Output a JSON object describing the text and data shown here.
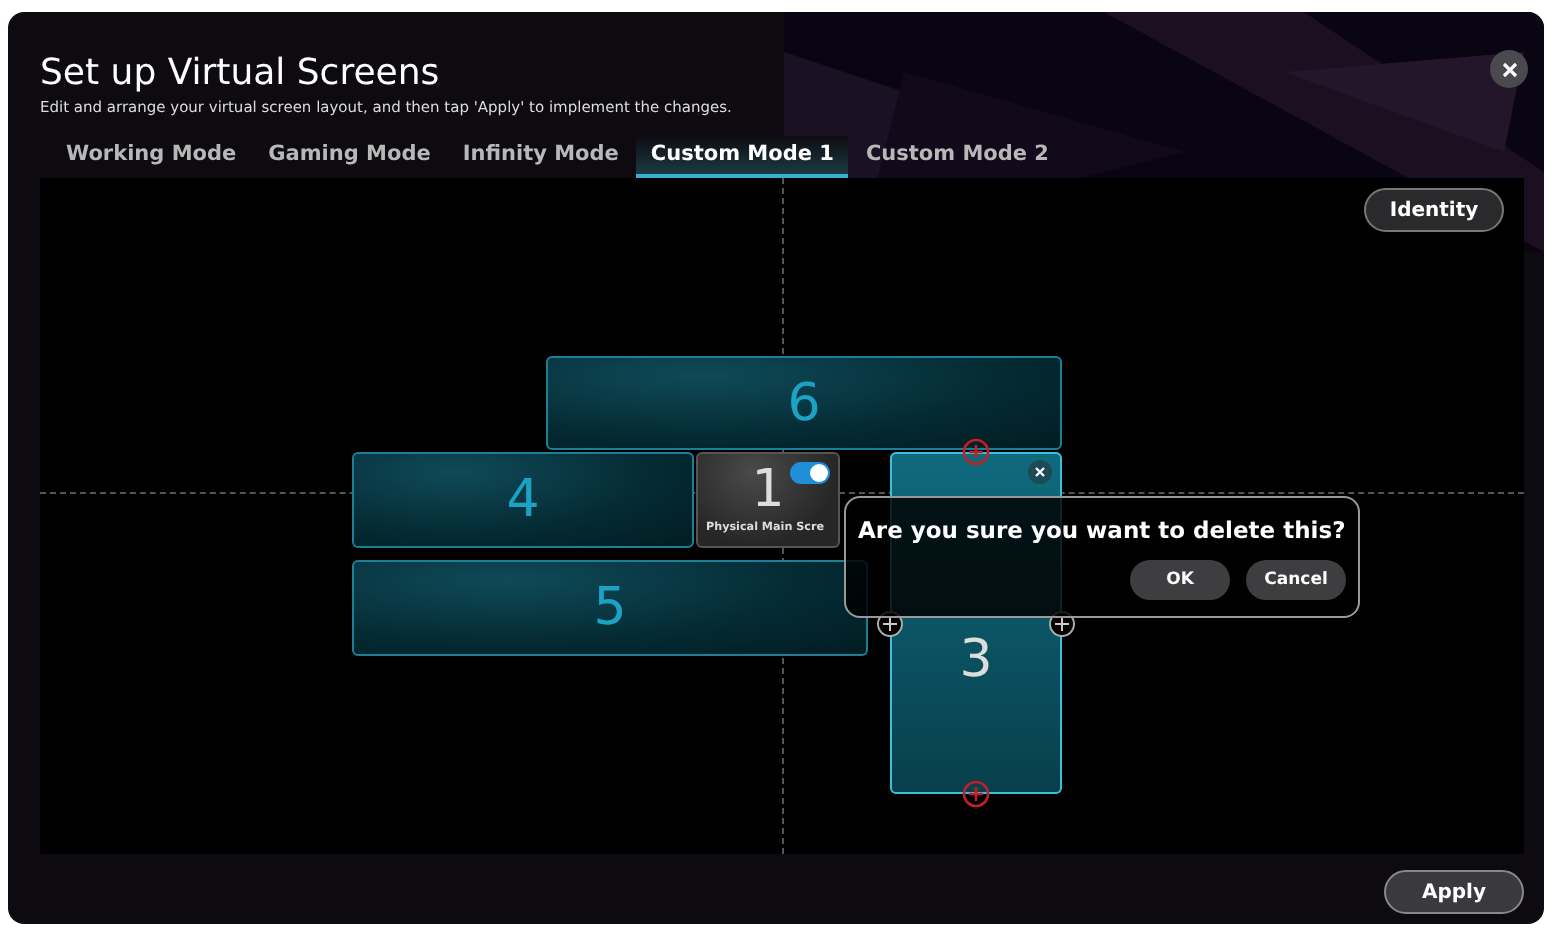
{
  "title": "Set up Virtual Screens",
  "subtitle": "Edit and arrange your virtual screen layout, and then tap 'Apply' to implement the changes.",
  "tabs": [
    {
      "label": "Working Mode",
      "selected": false
    },
    {
      "label": "Gaming Mode",
      "selected": false
    },
    {
      "label": "Infinity Mode",
      "selected": false
    },
    {
      "label": "Custom Mode 1",
      "selected": true
    },
    {
      "label": "Custom Mode 2",
      "selected": false
    }
  ],
  "identity_button": "Identity",
  "screens": [
    {
      "number": "6",
      "kind": "virtual",
      "selected": false
    },
    {
      "number": "4",
      "kind": "virtual",
      "selected": false
    },
    {
      "number": "1",
      "kind": "physical",
      "selected": false,
      "on": true,
      "label": "Physical Main Scre"
    },
    {
      "number": "5",
      "kind": "virtual",
      "selected": false
    },
    {
      "number": "3",
      "kind": "virtual",
      "selected": true
    }
  ],
  "dialog": {
    "message": "Are you sure you want to delete this?",
    "buttons": [
      "OK",
      "Cancel"
    ]
  },
  "apply_button": "Apply"
}
